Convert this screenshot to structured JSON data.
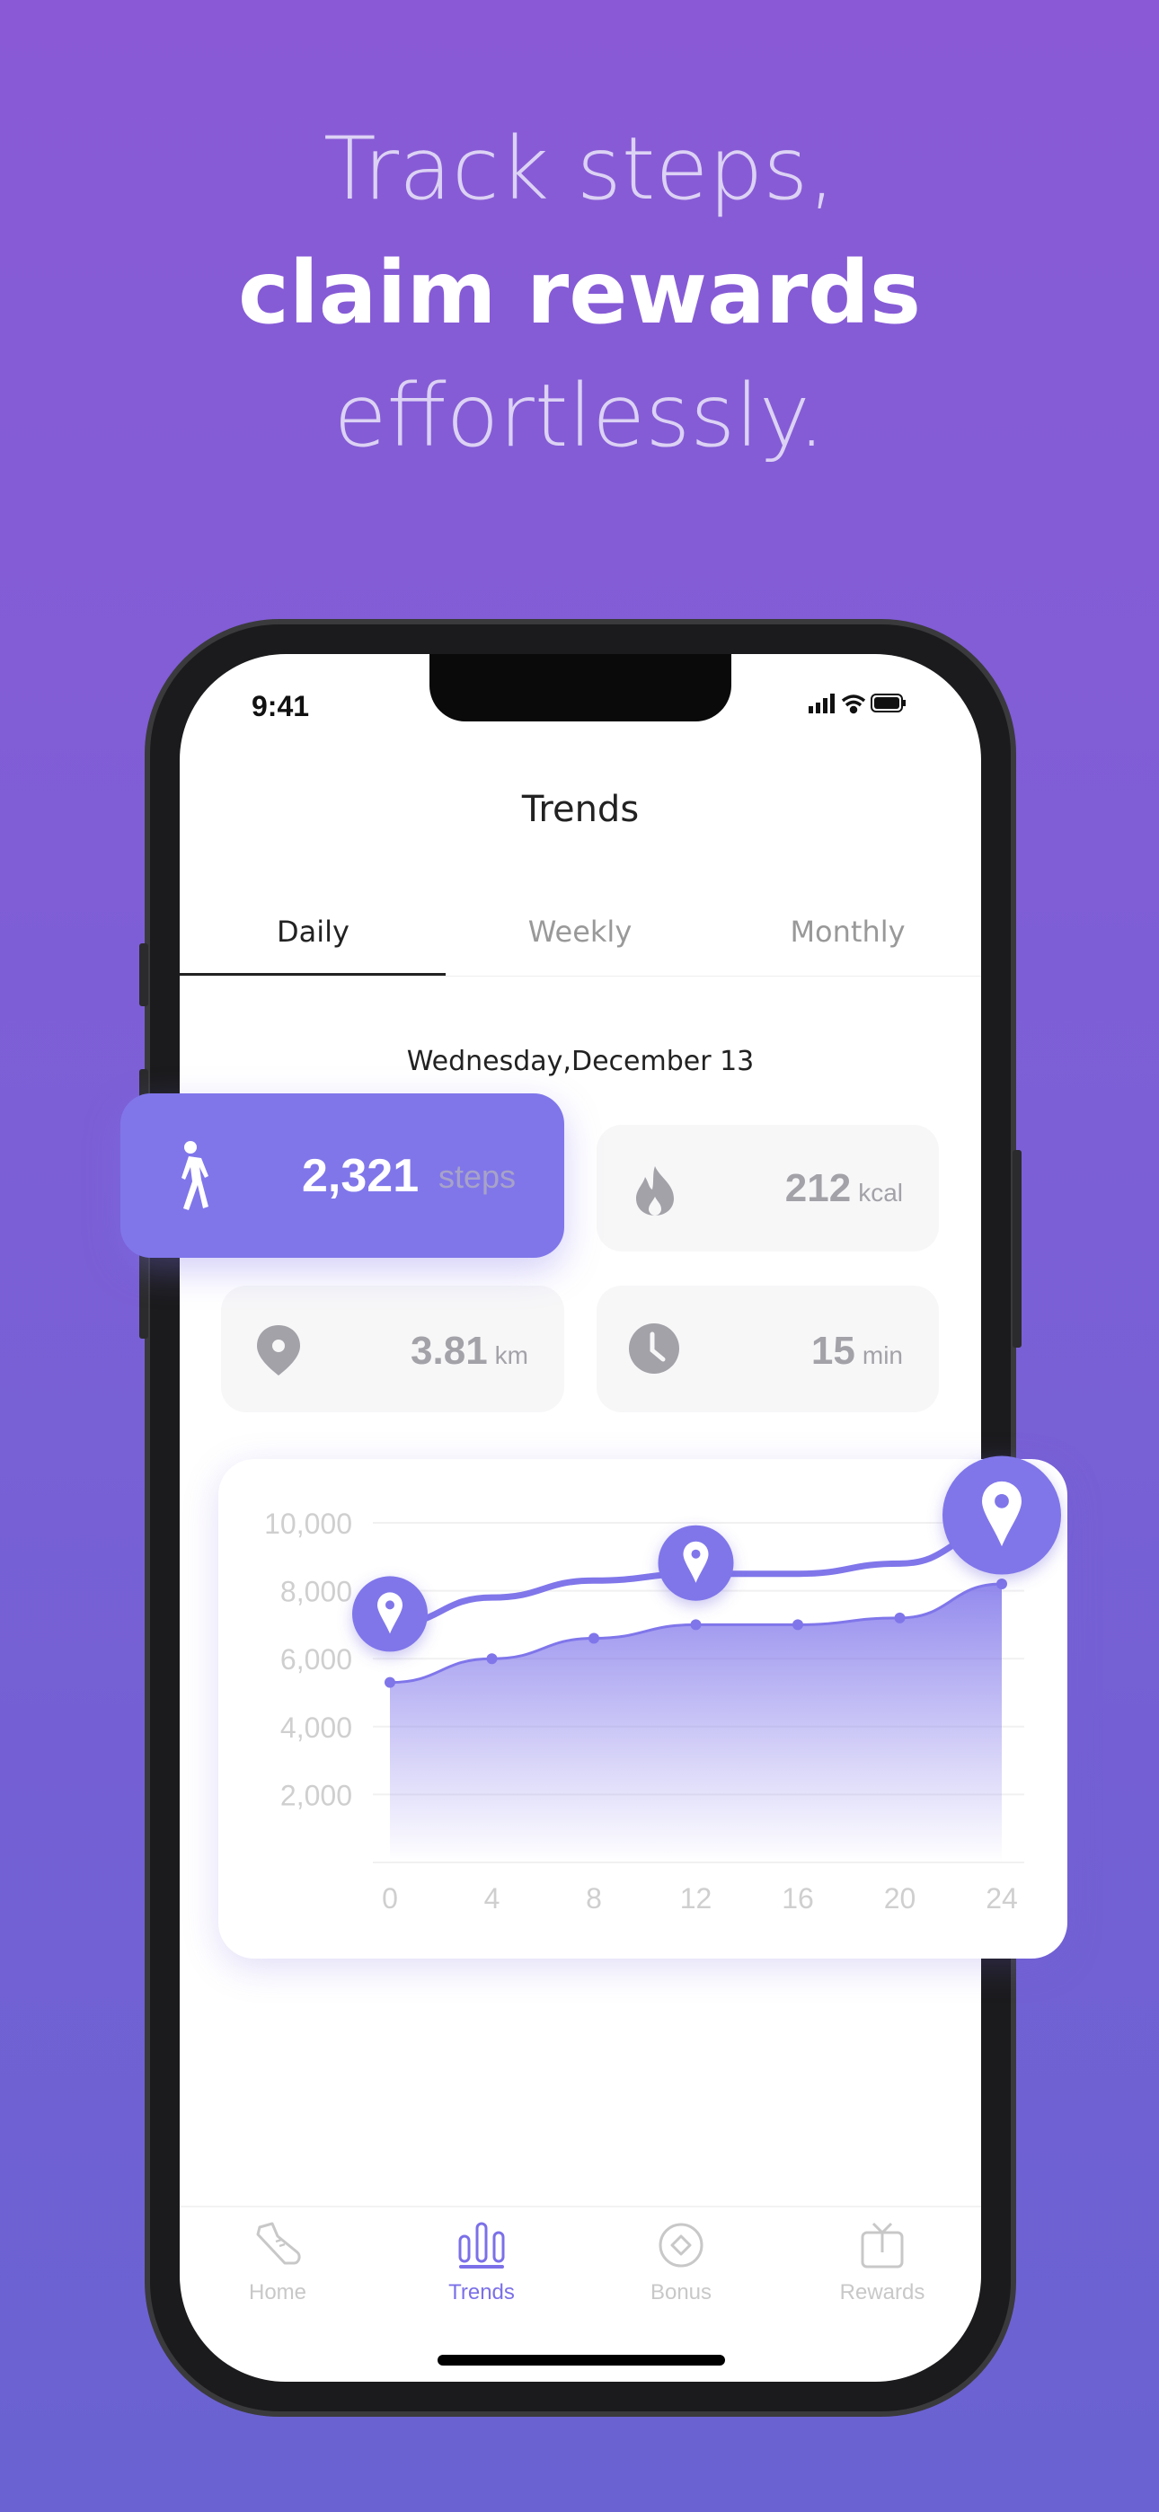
{
  "headline": {
    "line1": "Track steps,",
    "line2": "claim rewards",
    "line3": "effortlessly."
  },
  "status_bar": {
    "time": "9:41"
  },
  "header": {
    "title": "Trends"
  },
  "tabs": [
    {
      "label": "Daily",
      "active": true
    },
    {
      "label": "Weekly",
      "active": false
    },
    {
      "label": "Monthly",
      "active": false
    }
  ],
  "date": "Wednesday,December 13",
  "stats": {
    "steps": {
      "value": "2,321",
      "unit": "steps",
      "icon": "walking-icon"
    },
    "calories": {
      "value": "212",
      "unit": "kcal",
      "icon": "flame-icon"
    },
    "distance": {
      "value": "3.81",
      "unit": "km",
      "icon": "location-pin-icon"
    },
    "duration": {
      "value": "15",
      "unit": "min",
      "icon": "clock-icon"
    }
  },
  "chart_data": {
    "type": "area",
    "x": [
      0,
      4,
      8,
      12,
      16,
      20,
      24
    ],
    "xticks": [
      "0",
      "4",
      "8",
      "12",
      "16",
      "20",
      "24"
    ],
    "yticks": [
      "2,000",
      "4,000",
      "6,000",
      "8,000",
      "10,000"
    ],
    "ylim": [
      0,
      10000
    ],
    "grid": true,
    "series": [
      {
        "values": [
          5300,
          6000,
          6600,
          7000,
          7000,
          7200,
          8200
        ],
        "style": "area"
      },
      {
        "values": [
          7000,
          7800,
          8300,
          8500,
          8500,
          8800,
          9800
        ],
        "style": "line",
        "markers_at": [
          0,
          12,
          24
        ],
        "marker_icon": "location-pin-icon"
      }
    ],
    "accent": "#8076ea"
  },
  "nav": [
    {
      "label": "Home",
      "icon": "sneaker-icon",
      "active": false
    },
    {
      "label": "Trends",
      "icon": "bar-chart-icon",
      "active": true
    },
    {
      "label": "Bonus",
      "icon": "coin-icon",
      "active": false
    },
    {
      "label": "Rewards",
      "icon": "gift-tv-icon",
      "active": false
    }
  ],
  "colors": {
    "accent": "#8076ea",
    "background_top": "#8a5ad6",
    "background_bottom": "#6a62d2"
  }
}
